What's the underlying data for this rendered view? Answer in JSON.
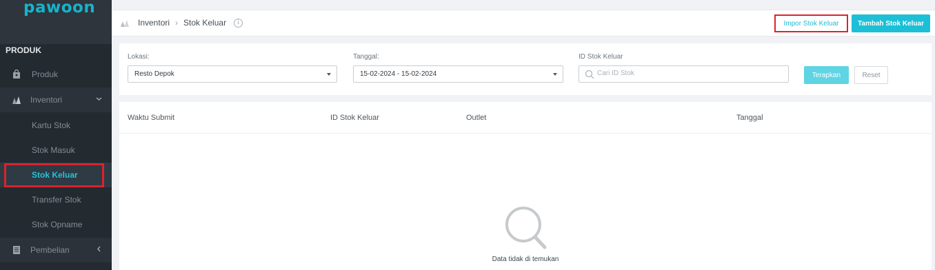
{
  "app": {
    "logo": "pawoon"
  },
  "sidebar": {
    "section_header": "PRODUK",
    "items": {
      "produk": "Produk",
      "inventori": "Inventori",
      "kartu_stok": "Kartu Stok",
      "stok_masuk": "Stok Masuk",
      "stok_keluar": "Stok Keluar",
      "transfer_stok": "Transfer Stok",
      "stok_opname": "Stok Opname",
      "pembelian": "Pembelian"
    },
    "active": "Stok Keluar"
  },
  "topbar": {
    "breadcrumb": [
      "Inventori",
      "Stok Keluar"
    ],
    "import_label": "Impor Stok Keluar",
    "add_label": "Tambah Stok Keluar"
  },
  "filters": {
    "lokasi_label": "Lokasi:",
    "lokasi_value": "Resto Depok",
    "tanggal_label": "Tanggal:",
    "tanggal_value": "15-02-2024 - 15-02-2024",
    "id_label": "ID Stok Keluar",
    "id_placeholder": "Cari ID Stok",
    "apply_label": "Terapkan",
    "reset_label": "Reset"
  },
  "table": {
    "columns": [
      "Waktu Submit",
      "ID Stok Keluar",
      "Outlet",
      "Tanggal"
    ],
    "empty_text": "Data tidak di temukan"
  },
  "colors": {
    "accent": "#1cbfd6",
    "sidebar": "#232a30",
    "highlight": "#d9232e"
  }
}
